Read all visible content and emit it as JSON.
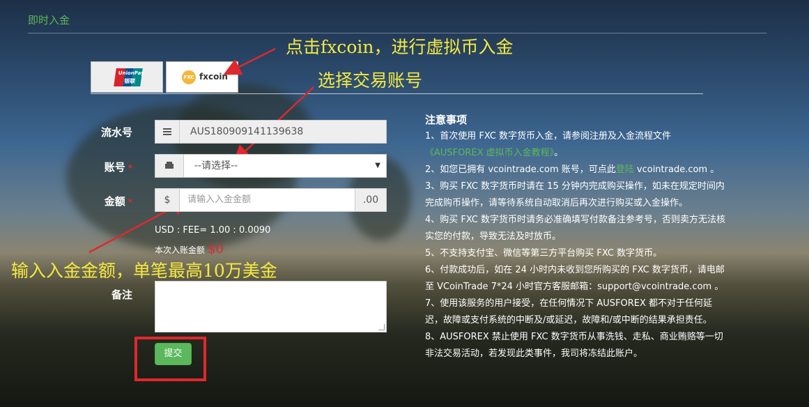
{
  "header": {
    "title": "即时入金"
  },
  "tabs": [
    {
      "name": "unionpay",
      "logo_text": "UnionPay",
      "logo_cn": "银联"
    },
    {
      "name": "fxcoin",
      "logo_text": "fxcoin",
      "badge": "FXC"
    }
  ],
  "annotations": {
    "click_fxcoin": "点击fxcoin，进行虚拟币入金",
    "select_account": "选择交易账号",
    "enter_amount": "输入入金金额，单笔最高10万美金"
  },
  "form": {
    "serial_label": "流水号",
    "serial_value": "AUS180909141139638",
    "account_label": "账号",
    "account_value": "--请选择--",
    "amount_label": "金额",
    "amount_prefix": "$",
    "amount_placeholder": "请输入入金金额",
    "amount_suffix": ".00",
    "required_mark": "*",
    "fee_text": "USD : FEE= 1.00 : 0.0090",
    "arrival_label": "本次入账金额",
    "arrival_amount": "$0",
    "remark_label": "备注",
    "submit_label": "提交"
  },
  "notes": {
    "title": "注意事项",
    "l1": "1、首次使用 FXC 数字货币入金，请参阅注册及入金流程文件",
    "l1_link": "《AUSFOREX 虚拟币入金教程》",
    "l1_end": "。",
    "l2_a": "2、如您已拥有 vcointrade.com 账号，可点此",
    "l2_link": "登陆",
    "l2_b": " vcointrade.com 。",
    "l3a": "3、购买 FXC 数字货币时请在 15 分钟内完成购买操作，如未在规定时间内",
    "l3b": "完成购币操作，请等待系统自动取消后再次进行购买或入金操作。",
    "l4a": "4、购买 FXC 数字货币时请务必准确填写付款备注参考号，否则卖方无法核",
    "l4b": "实您的付款，导致无法及时放币。",
    "l5": "5、不支持支付宝、微信等第三方平台购买 FXC 数字货币。",
    "l6a": "6、付款成功后，如在 24 小时内未收到您所购买的 FXC 数字货币，请电邮",
    "l6b": "至 VCoinTrade 7*24 小时官方客服邮箱：support@vcointrade.com 。",
    "l7a": "7、使用该服务的用户接受，在任何情况下 AUSFOREX 都不对于任何延",
    "l7b": "迟，故障或支付系统的中断及/或延迟，故障和/或中断的结果承担责任。",
    "l8a": "8、AUSFOREX 禁止使用 FXC 数字货币从事洗钱、走私、商业贿赂等一切",
    "l8b": "非法交易活动，若发现此类事件，我司将冻结此账户。"
  },
  "colors": {
    "green": "#5cb85c",
    "annotation": "#f5ea3f",
    "highlight": "#e0282d"
  },
  "icons": {
    "serial": "menu-icon",
    "account": "keyboard-icon"
  }
}
